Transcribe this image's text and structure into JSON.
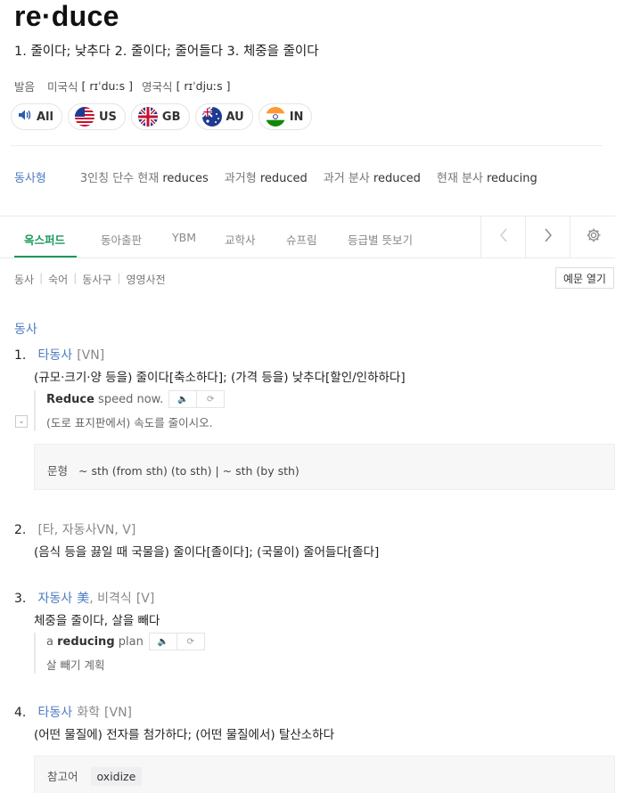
{
  "entry": {
    "headword": "re·duce",
    "summary": "1. 줄이다; 낮추다 2. 줄이다; 줄어들다 3. 체중을 줄이다"
  },
  "pronunciation": {
    "label": "발음",
    "us_label": "미국식",
    "us_ipa": "[ rɪˈduːs ]",
    "uk_label": "영국식",
    "uk_ipa": "[ rɪˈdjuːs ]"
  },
  "audio_buttons": [
    {
      "label": "All",
      "icon": "speaker-icon"
    },
    {
      "label": "US",
      "icon": "flag-us-icon"
    },
    {
      "label": "GB",
      "icon": "flag-gb-icon"
    },
    {
      "label": "AU",
      "icon": "flag-au-icon"
    },
    {
      "label": "IN",
      "icon": "flag-in-icon"
    }
  ],
  "verb_forms": {
    "label": "동사형",
    "items": [
      {
        "name": "3인칭 단수 현재",
        "value": "reduces"
      },
      {
        "name": "과거형",
        "value": "reduced"
      },
      {
        "name": "과거 분사",
        "value": "reduced"
      },
      {
        "name": "현재 분사",
        "value": "reducing"
      }
    ]
  },
  "tabs": [
    "옥스퍼드",
    "동아출판",
    "YBM",
    "교학사",
    "슈프림",
    "등급별 뜻보기"
  ],
  "active_tab": "옥스퍼드",
  "filters": [
    "동사",
    "숙어",
    "동사구",
    "영영사전"
  ],
  "example_toggle_label": "예문 열기",
  "pos_heading": "동사",
  "senses": {
    "s1": {
      "num": "1.",
      "tag": "타동사",
      "tag_extra": "[VN]",
      "definition": "(규모·크기·양 등을) 줄이다[축소하다]; (가격 등을) 낮추다[할인/인하하다]",
      "example_bold": "Reduce",
      "example_rest": " speed now.",
      "example_ko": "(도로 표지판에서) 속도를 줄이시오.",
      "pattern_label": "문형",
      "pattern_value": "~ sth (from sth) (to sth) | ~ sth (by sth)"
    },
    "s2": {
      "num": "2.",
      "tag": "[타, 자동사VN, V]",
      "definition": "(음식 등을 끓일 때 국물을) 줄이다[졸이다]; (국물이) 줄어들다[졸다]"
    },
    "s3": {
      "num": "3.",
      "tag": "자동사",
      "tag_extra1": "美",
      "tag_extra2": ", 비격식",
      "tag_extra3": "[V]",
      "definition": "체중을 줄이다, 살을 빼다",
      "example_pre": "a ",
      "example_bold": "reducing",
      "example_rest": " plan",
      "example_ko": "살 빼기 계획"
    },
    "s4": {
      "num": "4.",
      "tag": "타동사",
      "tag_extra1": "화학",
      "tag_extra2": "[VN]",
      "definition": "(어떤 물질에) 전자를 첨가하다; (어떤 물질에서) 탈산소하다",
      "ref_label": "참고어",
      "ref_value": "oxidize"
    }
  },
  "colors": {
    "accent_green": "#1a9a5b",
    "link_blue": "#4e7cc0"
  }
}
